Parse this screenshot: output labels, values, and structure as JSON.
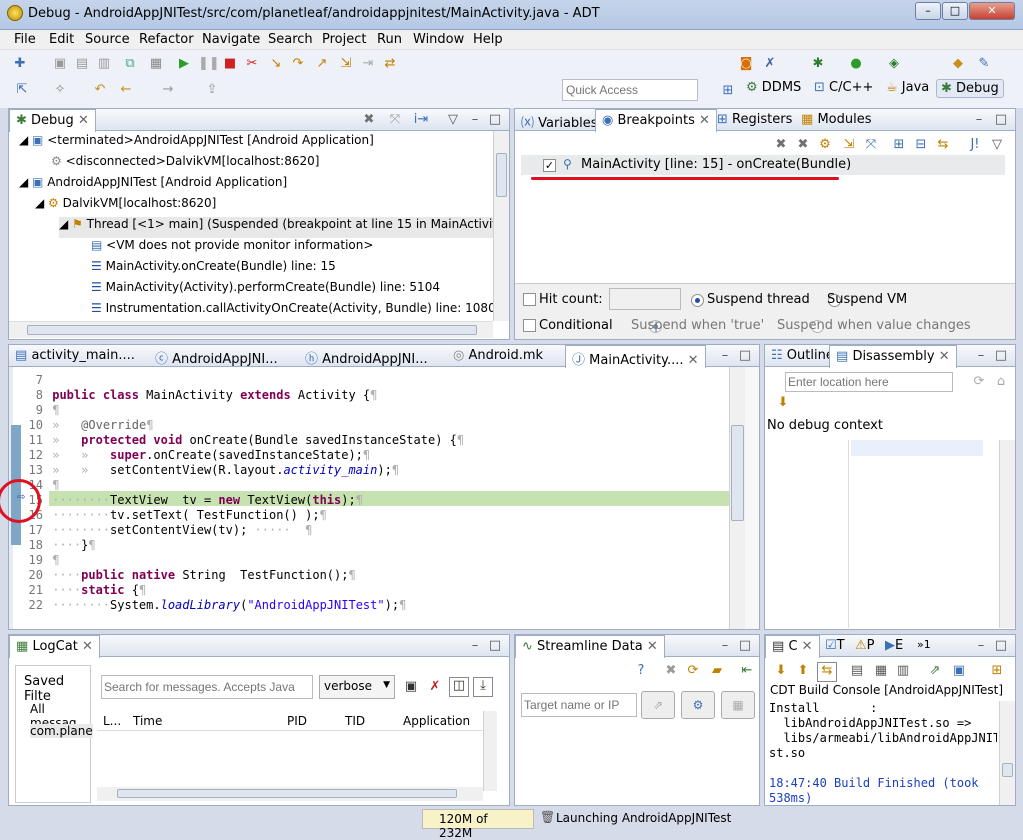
{
  "window": {
    "title": "Debug - AndroidAppJNITest/src/com/planetleaf/androidappjnitest/MainActivity.java - ADT"
  },
  "menu": [
    "File",
    "Edit",
    "Source",
    "Refactor",
    "Navigate",
    "Search",
    "Project",
    "Run",
    "Window",
    "Help"
  ],
  "quick_access": {
    "placeholder": "Quick Access"
  },
  "perspectives": [
    "DDMS",
    "C/C++",
    "Java",
    "Debug"
  ],
  "debug_view": {
    "tab": "Debug",
    "rows": [
      "<terminated>AndroidAppJNITest [Android Application]",
      "<disconnected>DalvikVM[localhost:8620]",
      "AndroidAppJNITest [Android Application]",
      "DalvikVM[localhost:8620]",
      "Thread [<1> main] (Suspended (breakpoint at line 15 in MainActivit",
      "<VM does not provide monitor information>",
      "MainActivity.onCreate(Bundle) line: 15",
      "MainActivity(Activity).performCreate(Bundle) line: 5104",
      "Instrumentation.callActivityOnCreate(Activity, Bundle) line: 1080"
    ]
  },
  "breakpoints_view": {
    "tabs": [
      "Variables",
      "Breakpoints",
      "Registers",
      "Modules"
    ],
    "entry": "MainActivity [line: 15] - onCreate(Bundle)",
    "hit_count_label": "Hit count:",
    "suspend_thread": "Suspend thread",
    "suspend_vm": "Suspend VM",
    "conditional": "Conditional",
    "when_true": "Suspend when 'true'",
    "when_changes": "Suspend when value changes"
  },
  "editor": {
    "tabs": [
      "activity_main....",
      "AndroidAppJNI...",
      "AndroidAppJNI...",
      "Android.mk",
      "MainActivity...."
    ],
    "lines": [
      {
        "n": "7",
        "t": ""
      },
      {
        "n": "8",
        "t": "public class MainActivity extends Activity {¶"
      },
      {
        "n": "9",
        "t": "¶"
      },
      {
        "n": "10",
        "t": "    @Override¶"
      },
      {
        "n": "11",
        "t": "    protected void onCreate(Bundle savedInstanceState) {¶"
      },
      {
        "n": "12",
        "t": "        super.onCreate(savedInstanceState);¶"
      },
      {
        "n": "13",
        "t": "        setContentView(R.layout.activity_main);¶"
      },
      {
        "n": "14",
        "t": "¶"
      },
      {
        "n": "15",
        "t": "        TextView  tv = new TextView(this);¶"
      },
      {
        "n": "16",
        "t": "        tv.setText( TestFunction() );¶"
      },
      {
        "n": "17",
        "t": "        setContentView(tv);      ¶"
      },
      {
        "n": "18",
        "t": "    }¶"
      },
      {
        "n": "19",
        "t": "¶"
      },
      {
        "n": "20",
        "t": "    public native String  TestFunction();¶"
      },
      {
        "n": "21",
        "t": "    static {¶"
      },
      {
        "n": "22",
        "t": "        System.loadLibrary(\"AndroidAppJNITest\");¶"
      }
    ]
  },
  "outline_view": {
    "tabs": [
      "Outline",
      "Disassembly"
    ],
    "location_placeholder": "Enter location here",
    "no_context": "No debug context"
  },
  "logcat": {
    "tab": "LogCat",
    "saved_filters": "Saved Filte",
    "all_messages": "All messag",
    "filter_item": "com.plane",
    "search_placeholder": "Search for messages. Accepts Java",
    "level": "verbose",
    "columns": [
      "L...",
      "Time",
      "PID",
      "TID",
      "Application"
    ]
  },
  "streamline": {
    "tab": "Streamline Data",
    "target_placeholder": "Target name or IP"
  },
  "console": {
    "tabs": [
      "C",
      "T",
      "P",
      "E",
      "1"
    ],
    "title": "CDT Build Console [AndroidAppJNITest]",
    "lines": [
      "Install       :",
      "  libAndroidAppJNITest.so =>",
      "  libs/armeabi/libAndroidAppJNITe",
      "st.so",
      "",
      "18:47:40 Build Finished (took",
      "538ms)"
    ]
  },
  "status": {
    "memory": "120M of 232M",
    "launching": "Launching AndroidAppJNITest"
  },
  "colors": {
    "annotation_red": "#e01020",
    "highlight": "#c6e2b0",
    "keyword": "#7f0055"
  }
}
